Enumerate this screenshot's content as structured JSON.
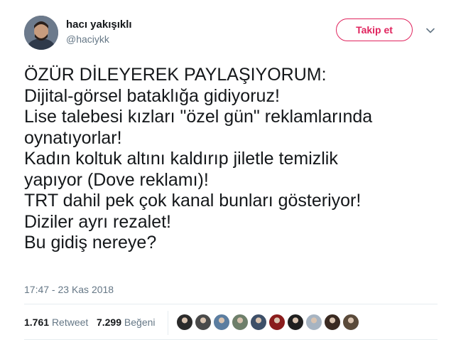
{
  "user": {
    "name": "hacı yakışıklı",
    "handle": "@haciykk"
  },
  "follow_button": {
    "label": "Takip et",
    "color": "#e0245e"
  },
  "tweet": {
    "lines": [
      "ÖZÜR DİLEYEREK PAYLAŞIYORUM:",
      "Dijital-görsel bataklığa gidiyoruz!",
      "Lise talebesi kızları \"özel gün\" reklamlarında",
      "oynatıyorlar!",
      "Kadın koltuk altını kaldırıp jiletle temizlik",
      "yapıyor (Dove reklamı)!",
      "TRT dahil pek çok kanal bunları gösteriyor!",
      "Diziler ayrı rezalet!",
      "Bu gidiş nereye?"
    ],
    "timestamp": "17:47 - 23 Kas 2018"
  },
  "stats": {
    "retweet_count": "1.761",
    "retweet_label": "Retweet",
    "like_count": "7.299",
    "like_label": "Beğeni"
  },
  "likers": {
    "count_shown": 10,
    "colors": [
      "#2b2b2b",
      "#4a4a4a",
      "#5b7da0",
      "#6e7f6a",
      "#3d4f68",
      "#8a1c1c",
      "#1f1f1f",
      "#a7b4c2",
      "#3a2a22",
      "#5a4a3a"
    ]
  },
  "icons": {
    "chevron": "chevron-down-icon"
  }
}
